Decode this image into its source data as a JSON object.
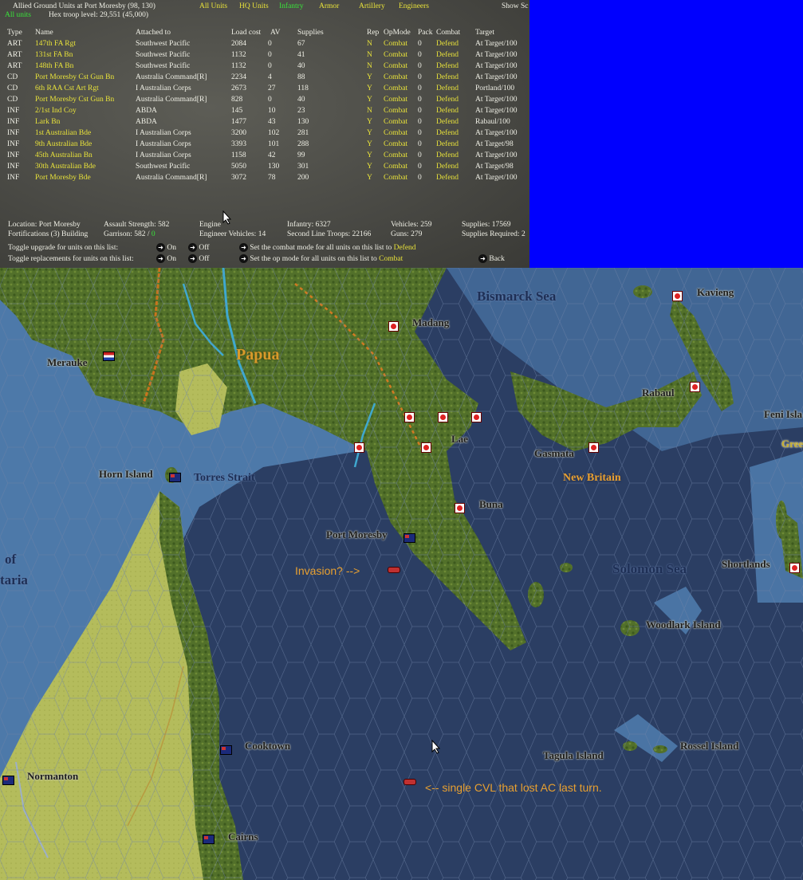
{
  "panel": {
    "title": "Allied Ground Units at Port Moresby  (98, 130)",
    "all_units_label": "All units",
    "troop_level": "Hex troop level: 29,551  (45,000)",
    "filters": [
      "All Units",
      "HQ Units",
      "Infantry",
      "Armor",
      "Artillery",
      "Engineers"
    ],
    "show_label": "Show Sc",
    "columns": {
      "type": "Type",
      "name": "Name",
      "attached": "Attached to",
      "load": "Load cost",
      "av": "AV",
      "supplies": "Supplies",
      "rep": "Rep",
      "opmode": "OpMode",
      "pack": "Pack",
      "combat": "Combat",
      "target": "Target"
    },
    "units": [
      {
        "type": "ART",
        "name": "147th FA Rgt",
        "attached": "Southwest Pacific",
        "load": "2084",
        "av": "0",
        "supplies": "67",
        "rep": "N",
        "opmode": "Combat",
        "pack": "0",
        "combat": "Defend",
        "target": "At Target/100"
      },
      {
        "type": "ART",
        "name": "131st FA Bn",
        "attached": "Southwest Pacific",
        "load": "1132",
        "av": "0",
        "supplies": "41",
        "rep": "N",
        "opmode": "Combat",
        "pack": "0",
        "combat": "Defend",
        "target": "At Target/100"
      },
      {
        "type": "ART",
        "name": "148th FA Bn",
        "attached": "Southwest Pacific",
        "load": "1132",
        "av": "0",
        "supplies": "40",
        "rep": "N",
        "opmode": "Combat",
        "pack": "0",
        "combat": "Defend",
        "target": "At Target/100"
      },
      {
        "type": "CD",
        "name": "Port Moresby Cst Gun Bn",
        "attached": "Australia Command[R]",
        "load": "2234",
        "av": "4",
        "supplies": "88",
        "rep": "Y",
        "opmode": "Combat",
        "pack": "0",
        "combat": "Defend",
        "target": "At Target/100"
      },
      {
        "type": "CD",
        "name": "6th RAA Cst Art Rgt",
        "attached": "I Australian Corps",
        "load": "2673",
        "av": "27",
        "supplies": "118",
        "rep": "Y",
        "opmode": "Combat",
        "pack": "0",
        "combat": "Defend",
        "target": "Portland/100"
      },
      {
        "type": "CD",
        "name": "Port Moresby Cst Gun Bn",
        "attached": "Australia Command[R]",
        "load": "828",
        "av": "0",
        "supplies": "40",
        "rep": "Y",
        "opmode": "Combat",
        "pack": "0",
        "combat": "Defend",
        "target": "At Target/100"
      },
      {
        "type": "INF",
        "name": "2/1st Ind Coy",
        "attached": "ABDA",
        "load": "145",
        "av": "10",
        "supplies": "23",
        "rep": "N",
        "opmode": "Combat",
        "pack": "0",
        "combat": "Defend",
        "target": "At Target/100"
      },
      {
        "type": "INF",
        "name": "Lark Bn",
        "attached": "ABDA",
        "load": "1477",
        "av": "43",
        "supplies": "130",
        "rep": "Y",
        "opmode": "Combat",
        "pack": "0",
        "combat": "Defend",
        "target": "Rabaul/100"
      },
      {
        "type": "INF",
        "name": "1st Australian Bde",
        "attached": "I Australian Corps",
        "load": "3200",
        "av": "102",
        "supplies": "281",
        "rep": "Y",
        "opmode": "Combat",
        "pack": "0",
        "combat": "Defend",
        "target": "At Target/100"
      },
      {
        "type": "INF",
        "name": "9th Australian Bde",
        "attached": "I Australian Corps",
        "load": "3393",
        "av": "101",
        "supplies": "288",
        "rep": "Y",
        "opmode": "Combat",
        "pack": "0",
        "combat": "Defend",
        "target": "At Target/98"
      },
      {
        "type": "INF",
        "name": "45th Australian Bn",
        "attached": "I Australian Corps",
        "load": "1158",
        "av": "42",
        "supplies": "99",
        "rep": "Y",
        "opmode": "Combat",
        "pack": "0",
        "combat": "Defend",
        "target": "At Target/100"
      },
      {
        "type": "INF",
        "name": "30th Australian Bde",
        "attached": "Southwest Pacific",
        "load": "5050",
        "av": "130",
        "supplies": "301",
        "rep": "Y",
        "opmode": "Combat",
        "pack": "0",
        "combat": "Defend",
        "target": "At Target/98"
      },
      {
        "type": "INF",
        "name": "Port Moresby Bde",
        "attached": "Australia Command[R]",
        "load": "3072",
        "av": "78",
        "supplies": "200",
        "rep": "Y",
        "opmode": "Combat",
        "pack": "0",
        "combat": "Defend",
        "target": "At Target/100"
      }
    ],
    "summary": {
      "location": "Location: Port Moresby",
      "assault": "Assault Strength: 582",
      "engine1": "Engine",
      "infantry": "Infantry: 6327",
      "vehicles": "Vehicles: 259",
      "supplies": "Supplies: 17569",
      "fortifications": "Fortifications (3) Building",
      "garrison": "Garrison: 582 /",
      "garrison_val": "0",
      "engine2": "Engineer Vehicles: 14",
      "second_line": "Second Line Troops: 22166",
      "guns": "Guns: 279",
      "supplies_req": "Supplies Required: 2"
    },
    "controls": {
      "upgrade_label": "Toggle upgrade for units on this list:",
      "replace_label": "Toggle replacements for units on this list:",
      "on": "On",
      "off": "Off",
      "combat_mode_label": "Set the combat mode for all units on this list to",
      "combat_mode_value": "Defend",
      "op_mode_label": "Set the op mode for all units on this list to",
      "op_mode_value": "Combat",
      "back": "Back"
    }
  },
  "map": {
    "labels": {
      "bismarck": "Bismarck Sea",
      "kavieng": "Kavieng",
      "madang": "Madang",
      "merauke": "Merauke",
      "papua": "Papua",
      "rabaul": "Rabaul",
      "feni": "Feni Isla",
      "gree": "Gree",
      "lae": "Lae",
      "gasmata": "Gasmata",
      "horn": "Horn Island",
      "torres": "Torres Strait",
      "newbritain": "New Britain",
      "buna": "Buna",
      "moresby": "Port Moresby",
      "solomon": "Solomon Sea",
      "shortlands": "Shortlands",
      "woodlark": "Woodlark Island",
      "of": "of",
      "taria": "taria",
      "cooktown": "Cooktown",
      "tagula": "Tagula Island",
      "rossel": "Rossel Island",
      "normanton": "Normanton",
      "cairns": "Cairns"
    },
    "annotations": {
      "invasion": "Invasion? -->",
      "cvl": "<-- single CVL that lost AC last turn."
    }
  },
  "colors": {
    "ocean_deep": "#2b3e63",
    "ocean_shallow": "#4e79a7",
    "land": "#5f7a2c",
    "plain": "#b9c060",
    "highlight": "#e8e23a",
    "green": "#39e23a",
    "blue_box": "#0000fe"
  }
}
